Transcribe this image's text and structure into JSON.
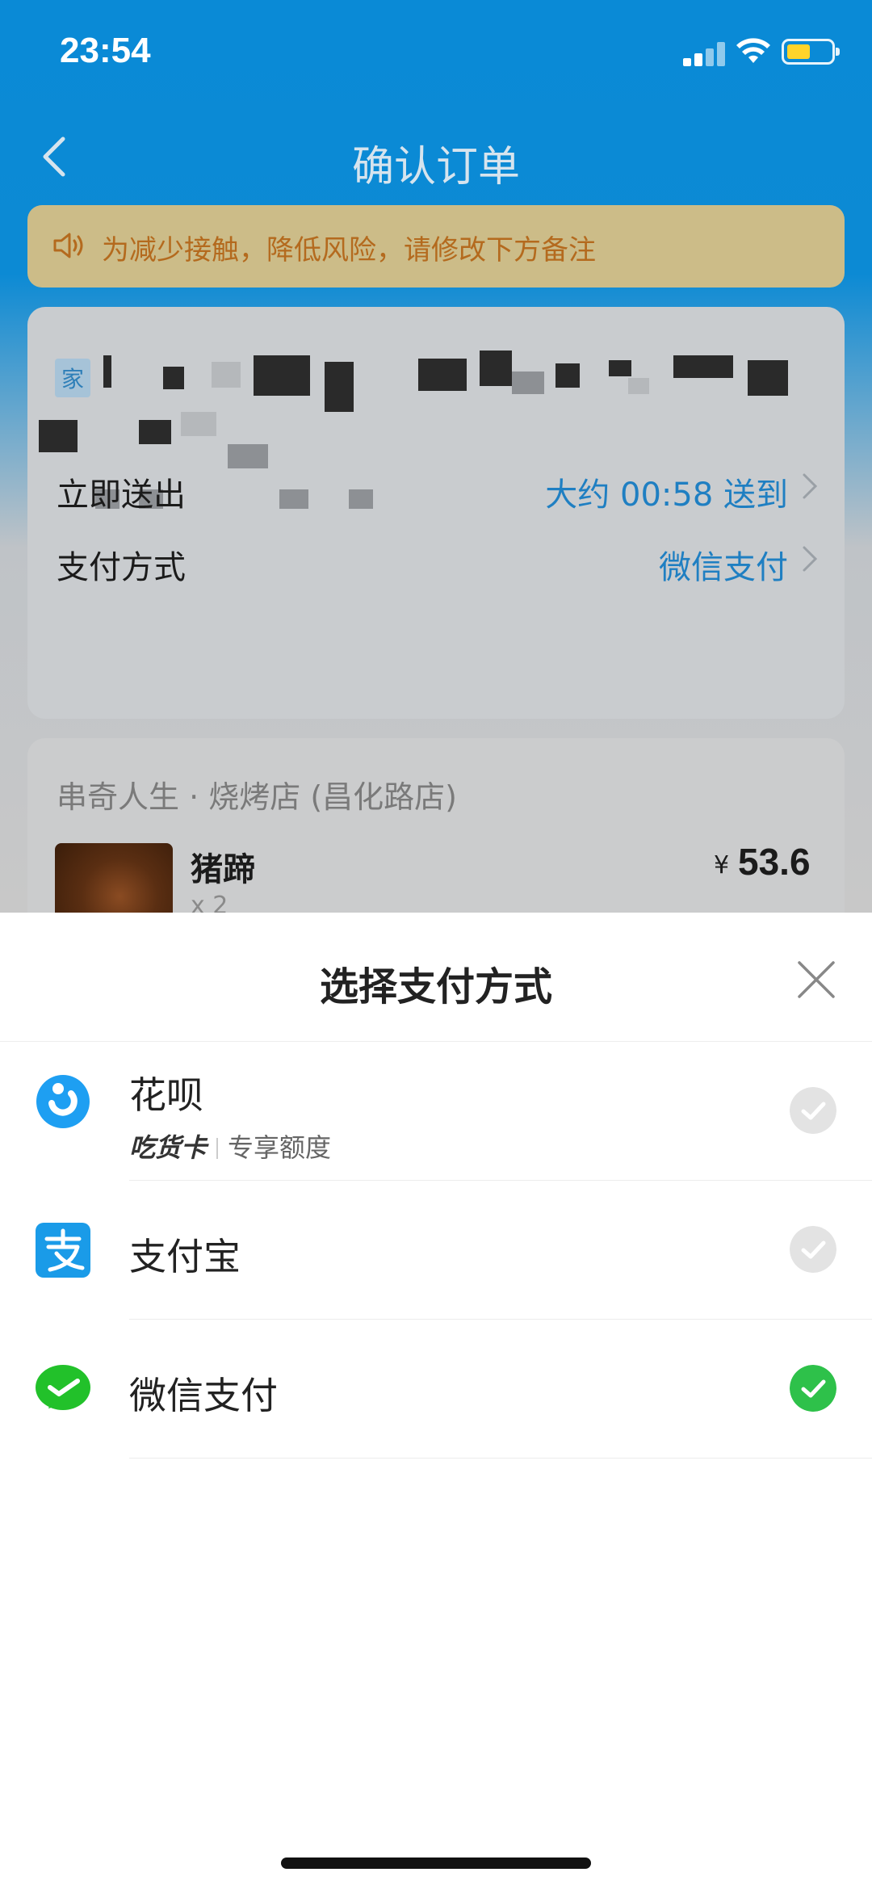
{
  "status_bar": {
    "time": "23:54"
  },
  "nav": {
    "title": "确认订单"
  },
  "notice": {
    "text": "为减少接触，降低风险，请修改下方备注"
  },
  "address": {
    "tag": "家"
  },
  "delivery": {
    "label": "立即送出",
    "value": "大约 00:58 送到"
  },
  "payment_row": {
    "label": "支付方式",
    "value": "微信支付"
  },
  "shop": {
    "name": "串奇人生 · 烧烤店 (昌化路店)",
    "item": {
      "name": "猪蹄",
      "qty": "x 2",
      "currency": "¥",
      "price": "53.6"
    }
  },
  "sheet": {
    "title": "选择支付方式",
    "options": [
      {
        "label": "花呗",
        "sub_brand": "吃货卡",
        "sub_text": "专享额度",
        "selected": false
      },
      {
        "label": "支付宝",
        "selected": false
      },
      {
        "label": "微信支付",
        "selected": true
      }
    ]
  },
  "colors": {
    "accent_blue": "#1f7fc2",
    "check_green": "#2ec14a",
    "check_grey": "#e3e3e3",
    "huabei_blue": "#1e9ff2",
    "alipay_blue": "#1a9be8",
    "wechat_green": "#22c12a"
  },
  "icons": [
    "back-chevron-icon",
    "speaker-icon",
    "chevron-right-icon",
    "close-icon",
    "huabei-icon",
    "alipay-icon",
    "wechat-pay-icon",
    "check-circle-icon"
  ]
}
